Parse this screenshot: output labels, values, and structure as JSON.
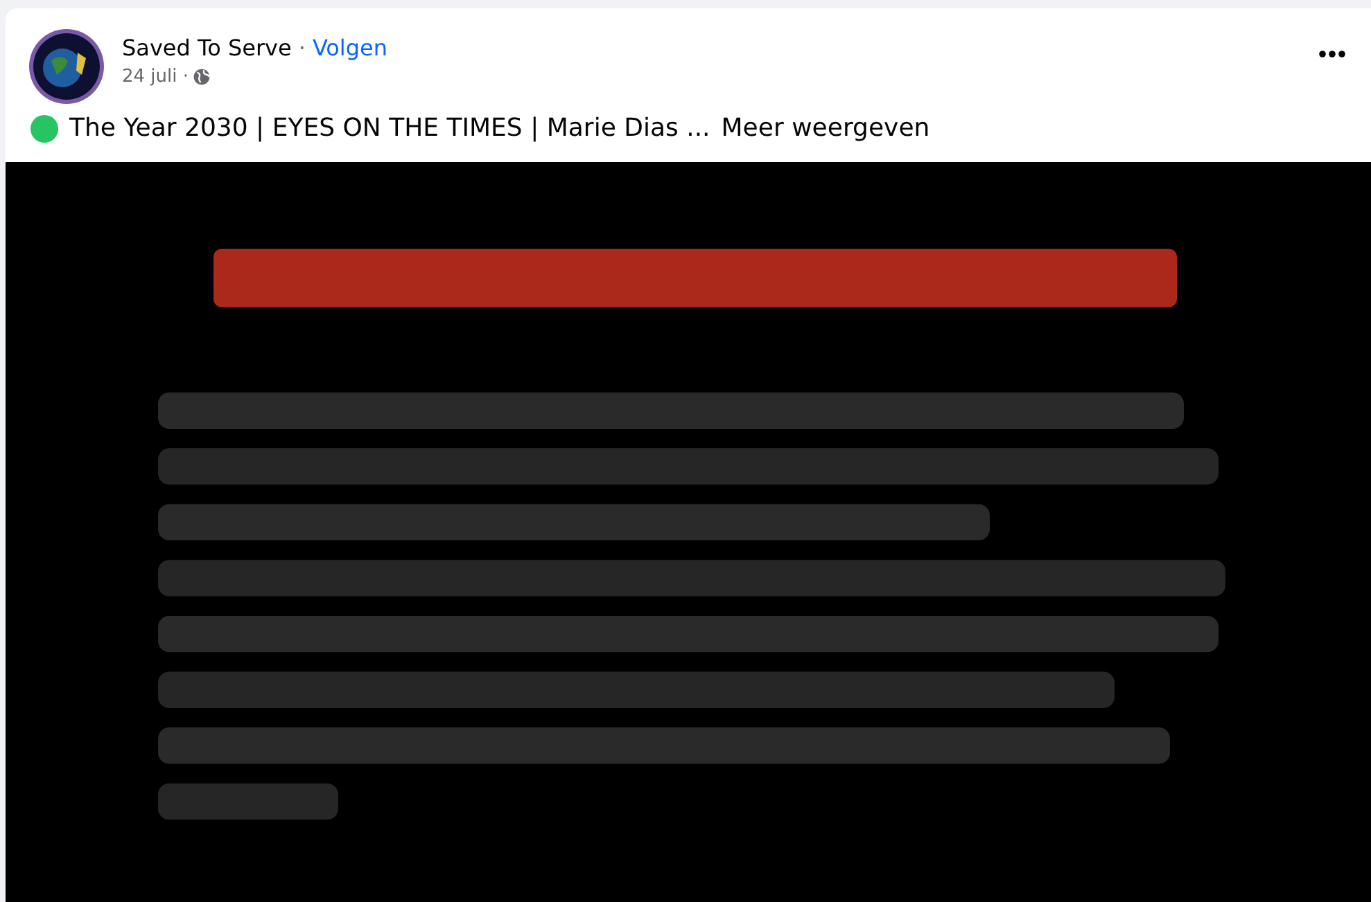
{
  "post": {
    "author": "Saved To Serve",
    "separator": "·",
    "follow": "Volgen",
    "date": "24 juli ·",
    "title": "The Year 2030 | EYES ON THE TIMES | Marie Dias ...",
    "more": "Meer weergeven"
  }
}
